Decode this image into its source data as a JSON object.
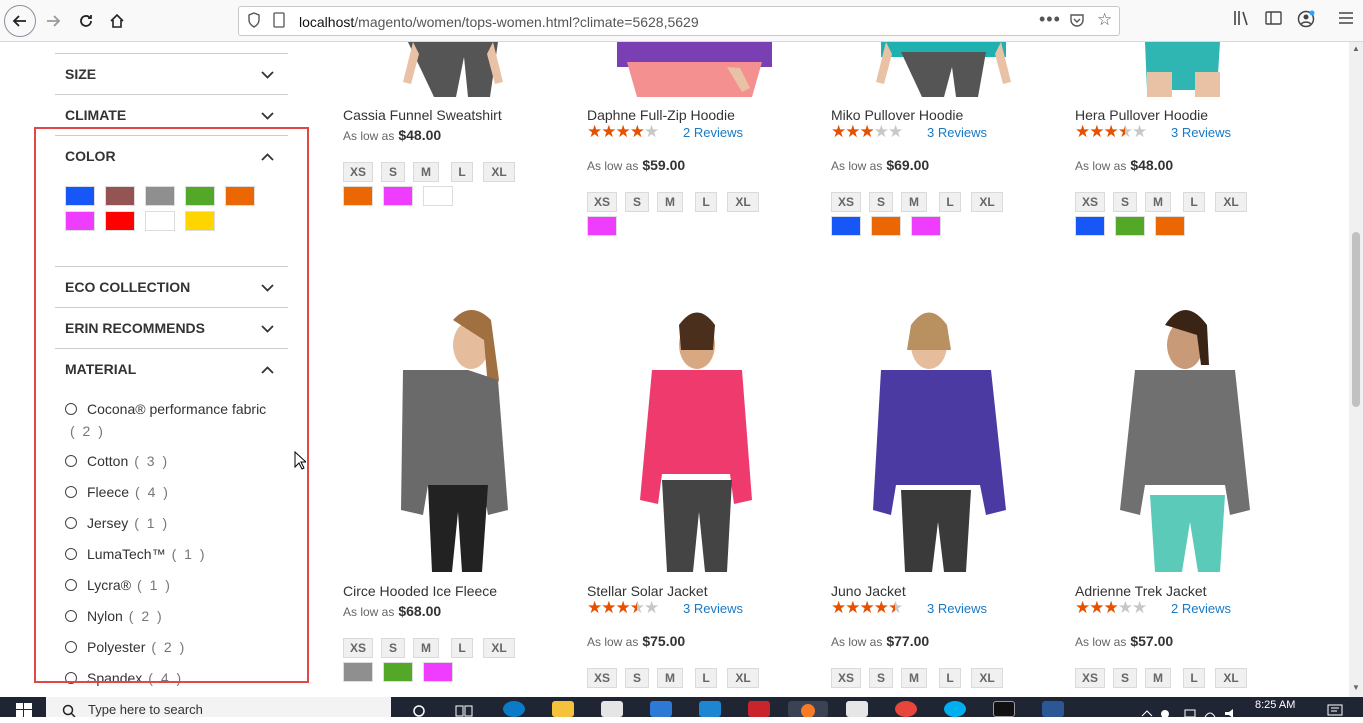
{
  "browser": {
    "url_host": "localhost",
    "url_path": "/magento/women/tops-women.html?climate=5628,5629"
  },
  "sidebar": {
    "size_label": "SIZE",
    "climate_label": "CLIMATE",
    "color_label": "COLOR",
    "eco_label": "ECO COLLECTION",
    "erin_label": "ERIN RECOMMENDS",
    "material_label": "MATERIAL",
    "colors": [
      "#1857f7",
      "#945454",
      "#8f8f8f",
      "#53a828",
      "#eb6703",
      "#ef3dff",
      "#ff0000",
      "#ffffff",
      "#ffd500"
    ],
    "materials": [
      {
        "name": "Cocona® performance fabric",
        "count": "( 2 )"
      },
      {
        "name": "Cotton",
        "count": "( 3 )"
      },
      {
        "name": "Fleece",
        "count": "( 4 )"
      },
      {
        "name": "Jersey",
        "count": "( 1 )"
      },
      {
        "name": "LumaTech™",
        "count": "( 1 )"
      },
      {
        "name": "Lycra®",
        "count": "( 1 )"
      },
      {
        "name": "Nylon",
        "count": "( 2 )"
      },
      {
        "name": "Polyester",
        "count": "( 2 )"
      },
      {
        "name": "Spandex",
        "count": "( 4 )"
      }
    ]
  },
  "products": {
    "row1": [
      {
        "name": "Cassia Funnel Sweatshirt",
        "price_prefix": "As low as",
        "price": "$48.00",
        "rating": 0,
        "reviews": "",
        "colors": [
          "#eb6703",
          "#ef3dff",
          "#ffffff"
        ]
      },
      {
        "name": "Daphne Full-Zip Hoodie",
        "price_prefix": "As low as",
        "price": "$59.00",
        "rating": 4,
        "reviews": "2 Reviews",
        "colors": [
          "#ef3dff"
        ]
      },
      {
        "name": "Miko Pullover Hoodie",
        "price_prefix": "As low as",
        "price": "$69.00",
        "rating": 3,
        "reviews": "3 Reviews",
        "colors": [
          "#1857f7",
          "#eb6703",
          "#ef3dff"
        ]
      },
      {
        "name": "Hera Pullover Hoodie",
        "price_prefix": "As low as",
        "price": "$48.00",
        "rating": 3.5,
        "reviews": "3 Reviews",
        "colors": [
          "#1857f7",
          "#53a828",
          "#eb6703"
        ]
      }
    ],
    "row2": [
      {
        "name": "Circe Hooded Ice Fleece",
        "price_prefix": "As low as",
        "price": "$68.00",
        "rating": 0,
        "reviews": "",
        "colors": [
          "#8f8f8f",
          "#53a828",
          "#ef3dff"
        ]
      },
      {
        "name": "Stellar Solar Jacket",
        "price_prefix": "As low as",
        "price": "$75.00",
        "rating": 3.5,
        "reviews": "3 Reviews",
        "colors": []
      },
      {
        "name": "Juno Jacket",
        "price_prefix": "As low as",
        "price": "$77.00",
        "rating": 4.5,
        "reviews": "3 Reviews",
        "colors": []
      },
      {
        "name": "Adrienne Trek Jacket",
        "price_prefix": "As low as",
        "price": "$57.00",
        "rating": 3,
        "reviews": "2 Reviews",
        "colors": []
      }
    ],
    "sizes": [
      "XS",
      "S",
      "M",
      "L",
      "XL"
    ]
  },
  "taskbar": {
    "search_placeholder": "Type here to search",
    "time": "8:25 AM"
  }
}
